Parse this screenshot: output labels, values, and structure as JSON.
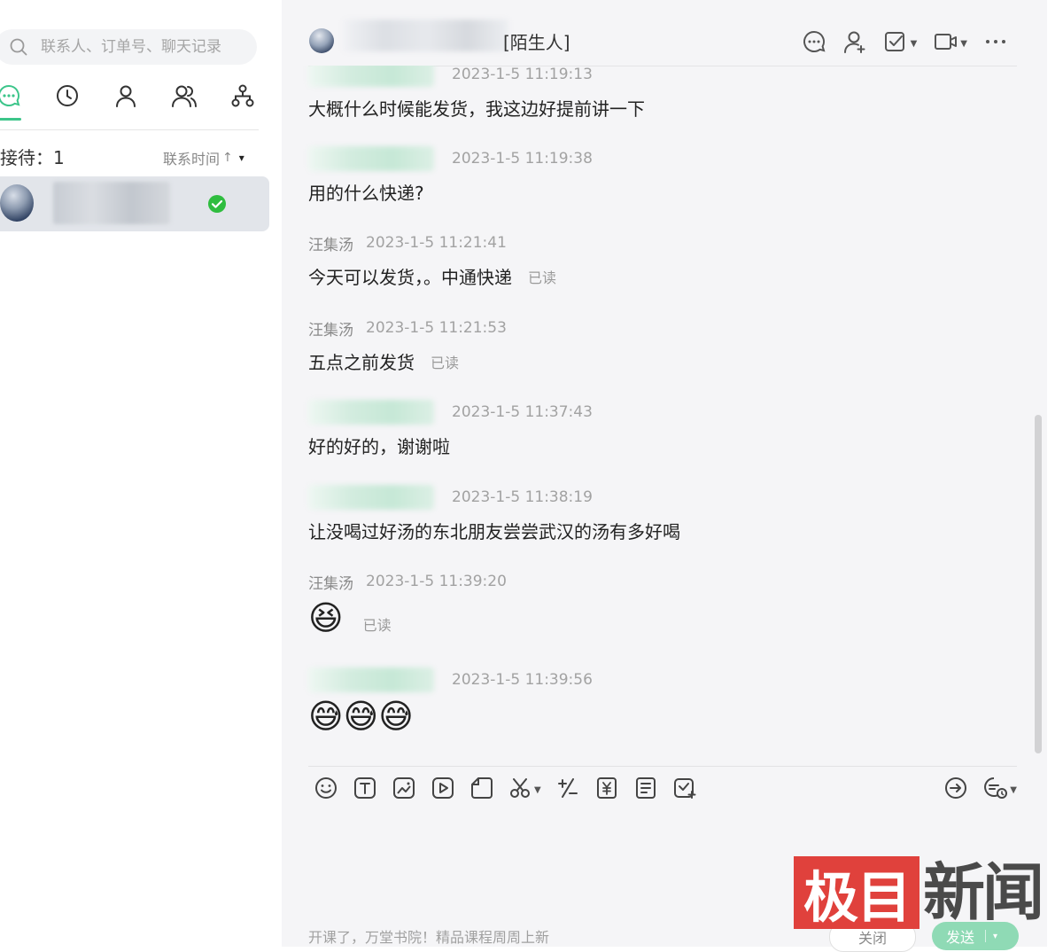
{
  "sidebar": {
    "search_placeholder": "联系人、订单号、聊天记录",
    "nav": [
      "chat-icon",
      "clock-icon",
      "person-icon",
      "people-icon",
      "org-icon"
    ],
    "reception_label": "接待：1",
    "sort_label": "联系时间",
    "sort_arrow": "↑",
    "sort_caret": "▾"
  },
  "header": {
    "tag": "[陌生人]",
    "tools": [
      "chat-transfer-icon",
      "user-add-icon",
      "task-check-icon",
      "video-icon",
      "more-icon"
    ]
  },
  "messages": [
    {
      "sender": "",
      "time": "2023-1-5 11:19:13",
      "text": "大概什么时候能发货，我这边好提前讲一下",
      "read": ""
    },
    {
      "sender": "",
      "time": "2023-1-5 11:19:38",
      "text": "用的什么快递?",
      "read": ""
    },
    {
      "sender": "汪集汤",
      "time": "2023-1-5 11:21:41",
      "text": "今天可以发货，。中通快递",
      "read": "已读"
    },
    {
      "sender": "汪集汤",
      "time": "2023-1-5 11:21:53",
      "text": "五点之前发货",
      "read": "已读"
    },
    {
      "sender": "",
      "time": "2023-1-5 11:37:43",
      "text": "好的好的，谢谢啦",
      "read": ""
    },
    {
      "sender": "",
      "time": "2023-1-5 11:38:19",
      "text": "让没喝过好汤的东北朋友尝尝武汉的汤有多好喝",
      "read": ""
    },
    {
      "sender": "汪集汤",
      "time": "2023-1-5 11:39:20",
      "text": "😆",
      "read": "已读"
    },
    {
      "sender": "",
      "time": "2023-1-5 11:39:56",
      "text": "😅😅😅",
      "read": ""
    }
  ],
  "composer": {
    "tools": [
      "emoji-icon",
      "text-icon",
      "image-icon",
      "video-play-icon",
      "file-icon",
      "scissors-icon",
      "calculator-icon",
      "coupon-icon",
      "invoice-icon",
      "order-icon"
    ],
    "promo": "开课了，万堂书院！精品课程周周上新",
    "close_label": "关闭",
    "send_label": "发送",
    "send_caret": "▾"
  },
  "watermark": {
    "red_text": "极目",
    "gray_text": "新闻"
  },
  "colors": {
    "accent": "#3cc58a",
    "send_button": "#8fdab5",
    "watermark_red": "#e0413c"
  }
}
